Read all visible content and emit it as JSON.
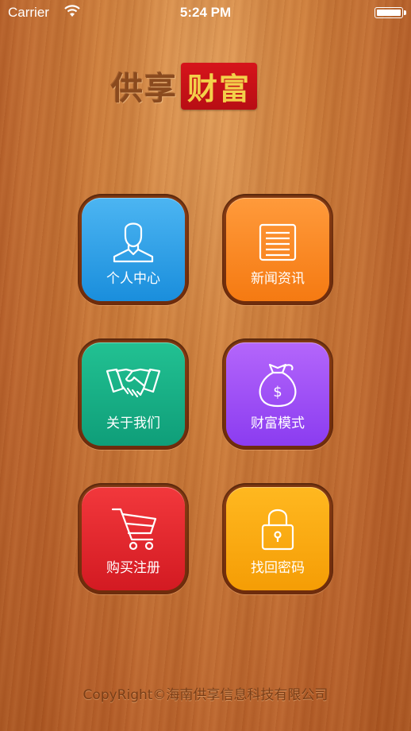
{
  "status_bar": {
    "carrier": "Carrier",
    "time": "5:24 PM"
  },
  "logo": {
    "left_text": "供享",
    "right_text": "财富"
  },
  "menu": {
    "personal_center": "个人中心",
    "news": "新闻资讯",
    "about_us": "关于我们",
    "wealth_mode": "财富模式",
    "buy_register": "购买注册",
    "recover_password": "找回密码"
  },
  "footer": {
    "copyright": "CopyRight©海南供享信息科技有限公司"
  },
  "colors": {
    "personal_center": "#2a9be6",
    "news": "#f88a25",
    "about_us": "#16b086",
    "wealth_mode": "#9f50f5",
    "buy_register": "#e32a30",
    "recover_password": "#fbac12"
  }
}
